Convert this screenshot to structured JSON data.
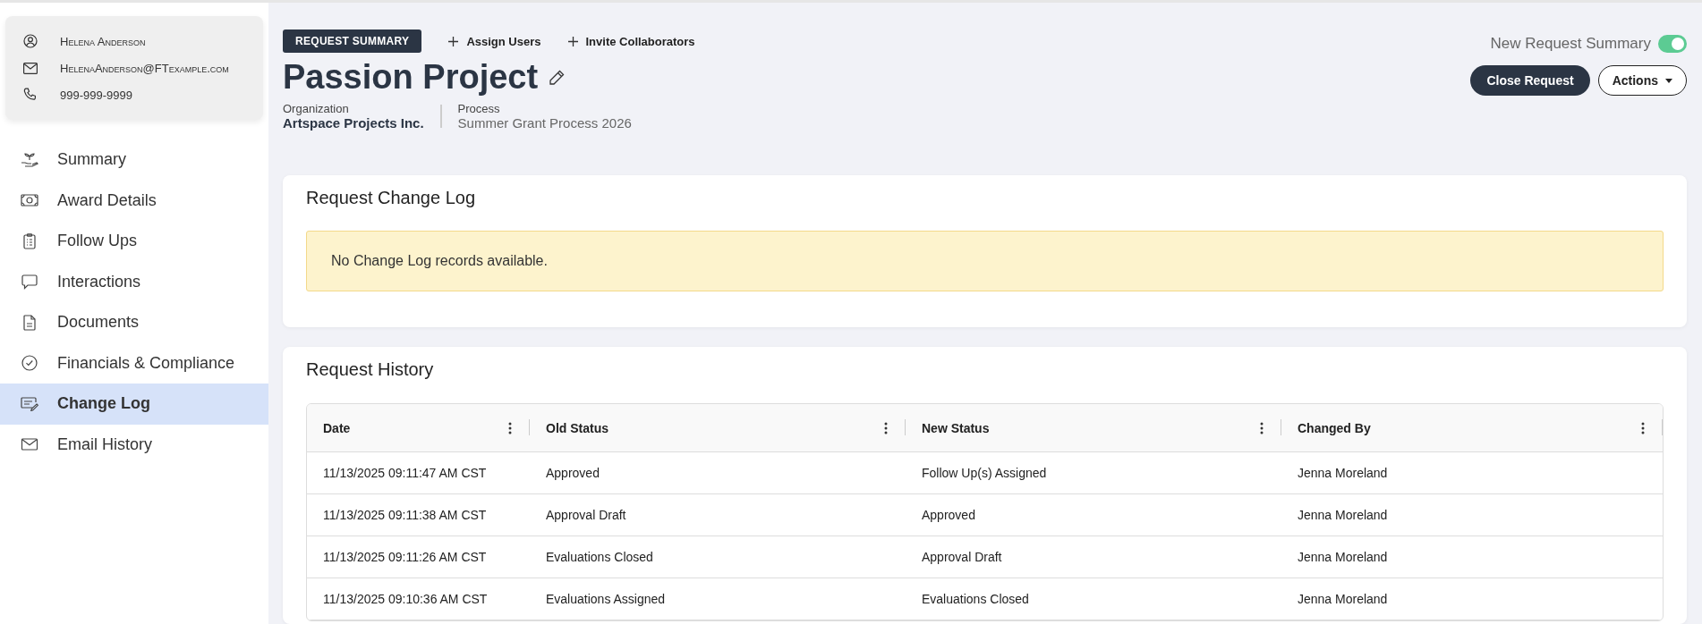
{
  "contact": {
    "name": "Helena Anderson",
    "email": "HelenaAnderson@FTexample.com",
    "phone": "999-999-9999"
  },
  "sidebar": {
    "items": [
      {
        "label": "Summary",
        "selected": false
      },
      {
        "label": "Award Details",
        "selected": false
      },
      {
        "label": "Follow Ups",
        "selected": false
      },
      {
        "label": "Interactions",
        "selected": false
      },
      {
        "label": "Documents",
        "selected": false
      },
      {
        "label": "Financials & Compliance",
        "selected": false
      },
      {
        "label": "Change Log",
        "selected": true
      },
      {
        "label": "Email History",
        "selected": false
      }
    ]
  },
  "header": {
    "badge": "REQUEST SUMMARY",
    "assign_users": "Assign Users",
    "invite_collaborators": "Invite Collaborators",
    "title": "Passion Project",
    "organization_label": "Organization",
    "organization": "Artspace Projects Inc.",
    "process_label": "Process",
    "process": "Summer Grant Process 2026",
    "toggle": {
      "label": "New Request Summary",
      "on": true
    },
    "close_button": "Close Request",
    "actions_button": "Actions"
  },
  "change_log": {
    "title": "Request Change Log",
    "alert": "No Change Log records available."
  },
  "history": {
    "title": "Request History",
    "columns": [
      "Date",
      "Old Status",
      "New Status",
      "Changed By"
    ],
    "rows": [
      [
        "11/13/2025 09:11:47 AM CST",
        "Approved",
        "Follow Up(s) Assigned",
        "Jenna Moreland"
      ],
      [
        "11/13/2025 09:11:38 AM CST",
        "Approval Draft",
        "Approved",
        "Jenna Moreland"
      ],
      [
        "11/13/2025 09:11:26 AM CST",
        "Evaluations Closed",
        "Approval Draft",
        "Jenna Moreland"
      ],
      [
        "11/13/2025 09:10:36 AM CST",
        "Evaluations Assigned",
        "Evaluations Closed",
        "Jenna Moreland"
      ]
    ]
  }
}
